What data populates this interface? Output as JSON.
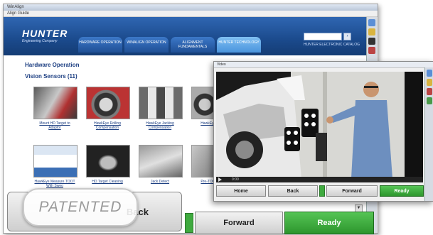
{
  "back_window": {
    "title": "WinAlign",
    "menu": "Align Guide",
    "header": {
      "logo": "HUNTER",
      "logo_sub": "Engineering Company",
      "tabs": [
        {
          "label": "HARDWARE OPERATION",
          "active": false
        },
        {
          "label": "WINALIGN OPERATION",
          "active": false
        },
        {
          "label": "ALIGNMENT FUNDAMENTALS",
          "active": false
        },
        {
          "label": "HUNTER TECHNOLOGY",
          "active": true
        }
      ],
      "link": "HUNTER ELECTRONIC CATALOG"
    },
    "content": {
      "title": "Hardware Operation",
      "subtitle": "Vision Sensors (11)",
      "thumbnails": [
        {
          "caption": "Mount HD Target to Adaptor"
        },
        {
          "caption": "HawkEye Rolling Compensation"
        },
        {
          "caption": "HawkEye Jacking Compensation"
        },
        {
          "caption": "HawkEye Ma..."
        },
        {
          "caption": "HawkEye Measure TOOT With Sweo"
        },
        {
          "caption": "HD Target Cleaning"
        },
        {
          "caption": "Jack Detect"
        },
        {
          "caption": "Pre-TOOTs T..."
        }
      ]
    },
    "buttons": {
      "back": "Back",
      "forward": "Forward",
      "ready": "Ready"
    }
  },
  "front_window": {
    "title": "Video",
    "video_time": "0:00",
    "buttons": {
      "home": "Home",
      "back": "Back",
      "forward": "Forward",
      "ready": "Ready"
    }
  },
  "badge": "PATENTED",
  "colors": {
    "brand_blue": "#1b4a8c",
    "ready_green": "#3faa3f",
    "link_blue": "#1d3f82"
  }
}
